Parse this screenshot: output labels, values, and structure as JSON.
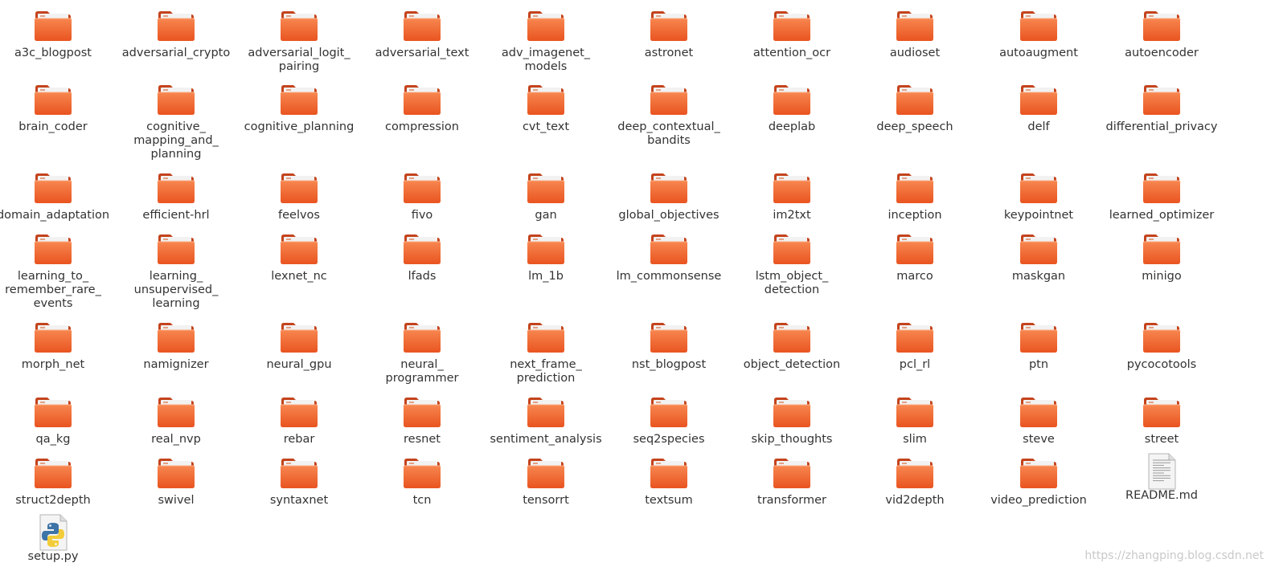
{
  "colors": {
    "folder_back": "#c4431c",
    "folder_front_top": "#f7864f",
    "folder_front_bottom": "#e95420",
    "paper": "#f2f2f2",
    "label_text": "#333333",
    "watermark": "#c9c9c9"
  },
  "files": [
    {
      "name": "a3c_blogpost",
      "icon": "folder-icon"
    },
    {
      "name": "adversarial_crypto",
      "icon": "folder-icon"
    },
    {
      "name": "adversarial_logit_\npairing",
      "icon": "folder-icon"
    },
    {
      "name": "adversarial_text",
      "icon": "folder-icon"
    },
    {
      "name": "adv_imagenet_\nmodels",
      "icon": "folder-icon"
    },
    {
      "name": "astronet",
      "icon": "folder-icon"
    },
    {
      "name": "attention_ocr",
      "icon": "folder-icon"
    },
    {
      "name": "audioset",
      "icon": "folder-icon"
    },
    {
      "name": "autoaugment",
      "icon": "folder-icon"
    },
    {
      "name": "autoencoder",
      "icon": "folder-icon"
    },
    {
      "name": "brain_coder",
      "icon": "folder-icon"
    },
    {
      "name": "cognitive_\nmapping_and_\nplanning",
      "icon": "folder-icon"
    },
    {
      "name": "cognitive_planning",
      "icon": "folder-icon"
    },
    {
      "name": "compression",
      "icon": "folder-icon"
    },
    {
      "name": "cvt_text",
      "icon": "folder-icon"
    },
    {
      "name": "deep_contextual_\nbandits",
      "icon": "folder-icon"
    },
    {
      "name": "deeplab",
      "icon": "folder-icon"
    },
    {
      "name": "deep_speech",
      "icon": "folder-icon"
    },
    {
      "name": "delf",
      "icon": "folder-icon"
    },
    {
      "name": "differential_privacy",
      "icon": "folder-icon"
    },
    {
      "name": "domain_adaptation",
      "icon": "folder-icon"
    },
    {
      "name": "efficient-hrl",
      "icon": "folder-icon"
    },
    {
      "name": "feelvos",
      "icon": "folder-icon"
    },
    {
      "name": "fivo",
      "icon": "folder-icon"
    },
    {
      "name": "gan",
      "icon": "folder-icon"
    },
    {
      "name": "global_objectives",
      "icon": "folder-icon"
    },
    {
      "name": "im2txt",
      "icon": "folder-icon"
    },
    {
      "name": "inception",
      "icon": "folder-icon"
    },
    {
      "name": "keypointnet",
      "icon": "folder-icon"
    },
    {
      "name": "learned_optimizer",
      "icon": "folder-icon"
    },
    {
      "name": "learning_to_\nremember_rare_\nevents",
      "icon": "folder-icon"
    },
    {
      "name": "learning_\nunsupervised_\nlearning",
      "icon": "folder-icon"
    },
    {
      "name": "lexnet_nc",
      "icon": "folder-icon"
    },
    {
      "name": "lfads",
      "icon": "folder-icon"
    },
    {
      "name": "lm_1b",
      "icon": "folder-icon"
    },
    {
      "name": "lm_commonsense",
      "icon": "folder-icon"
    },
    {
      "name": "lstm_object_\ndetection",
      "icon": "folder-icon"
    },
    {
      "name": "marco",
      "icon": "folder-icon"
    },
    {
      "name": "maskgan",
      "icon": "folder-icon"
    },
    {
      "name": "minigo",
      "icon": "folder-icon"
    },
    {
      "name": "morph_net",
      "icon": "folder-icon"
    },
    {
      "name": "namignizer",
      "icon": "folder-icon"
    },
    {
      "name": "neural_gpu",
      "icon": "folder-icon"
    },
    {
      "name": "neural_\nprogrammer",
      "icon": "folder-icon"
    },
    {
      "name": "next_frame_\nprediction",
      "icon": "folder-icon"
    },
    {
      "name": "nst_blogpost",
      "icon": "folder-icon"
    },
    {
      "name": "object_detection",
      "icon": "folder-icon"
    },
    {
      "name": "pcl_rl",
      "icon": "folder-icon"
    },
    {
      "name": "ptn",
      "icon": "folder-icon"
    },
    {
      "name": "pycocotools",
      "icon": "folder-icon"
    },
    {
      "name": "qa_kg",
      "icon": "folder-icon"
    },
    {
      "name": "real_nvp",
      "icon": "folder-icon"
    },
    {
      "name": "rebar",
      "icon": "folder-icon"
    },
    {
      "name": "resnet",
      "icon": "folder-icon"
    },
    {
      "name": "sentiment_analysis",
      "icon": "folder-icon"
    },
    {
      "name": "seq2species",
      "icon": "folder-icon"
    },
    {
      "name": "skip_thoughts",
      "icon": "folder-icon"
    },
    {
      "name": "slim",
      "icon": "folder-icon"
    },
    {
      "name": "steve",
      "icon": "folder-icon"
    },
    {
      "name": "street",
      "icon": "folder-icon"
    },
    {
      "name": "struct2depth",
      "icon": "folder-icon"
    },
    {
      "name": "swivel",
      "icon": "folder-icon"
    },
    {
      "name": "syntaxnet",
      "icon": "folder-icon"
    },
    {
      "name": "tcn",
      "icon": "folder-icon"
    },
    {
      "name": "tensorrt",
      "icon": "folder-icon"
    },
    {
      "name": "textsum",
      "icon": "folder-icon"
    },
    {
      "name": "transformer",
      "icon": "folder-icon"
    },
    {
      "name": "vid2depth",
      "icon": "folder-icon"
    },
    {
      "name": "video_prediction",
      "icon": "folder-icon"
    },
    {
      "name": "README.md",
      "icon": "text-file-icon"
    },
    {
      "name": "setup.py",
      "icon": "python-file-icon"
    }
  ],
  "watermark": "https://zhangping.blog.csdn.net"
}
